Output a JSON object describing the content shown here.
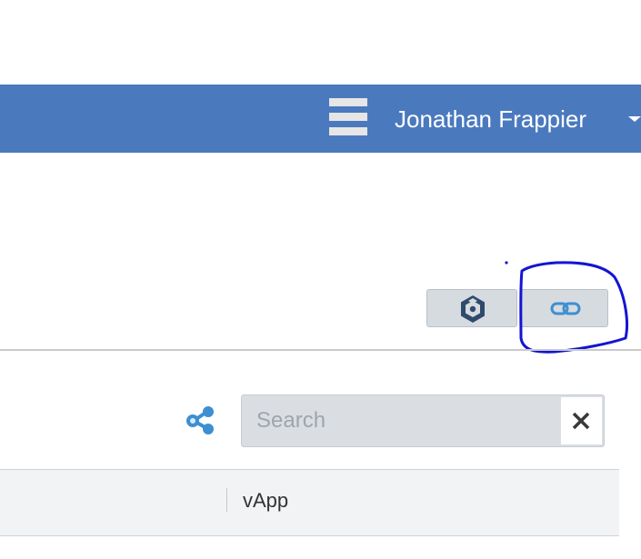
{
  "header": {
    "user_name": "Jonathan Frappier",
    "background_color": "#4a79be",
    "menu_icon": "hamburger-menu-icon",
    "user_menu_icon": "caret-down-icon"
  },
  "toolbar": {
    "buttons": [
      {
        "name": "vapp-view",
        "icon": "hexagon-cube-icon",
        "icon_color": "#2f4a6d"
      },
      {
        "name": "link-view",
        "icon": "link-icon",
        "icon_color": "#3d8fd1"
      }
    ],
    "annotation_color": "#1414d2"
  },
  "search": {
    "placeholder": "Search",
    "value": "",
    "filter_icon": "share-nodes-icon",
    "clear_icon": "close-icon"
  },
  "table": {
    "columns": [
      "vApp"
    ]
  }
}
